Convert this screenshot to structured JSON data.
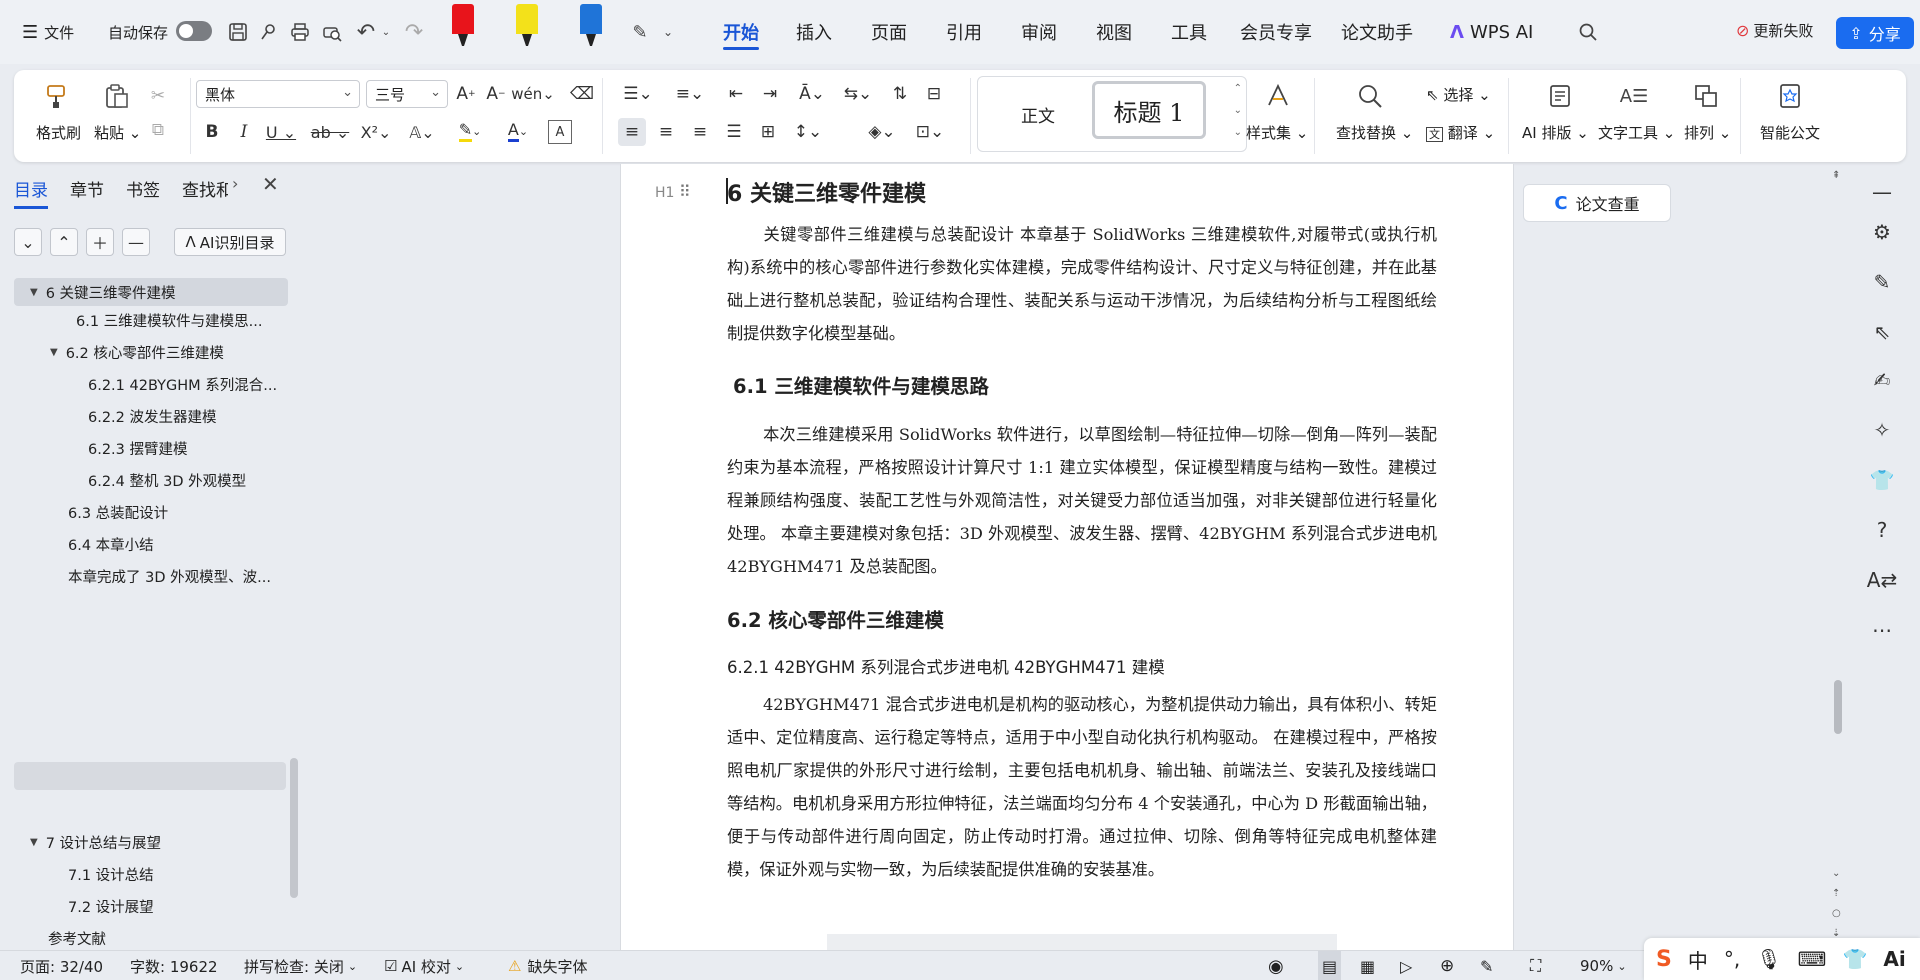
{
  "topbar": {
    "menu": "文件",
    "autosave": "自动保存",
    "tabs": [
      "开始",
      "插入",
      "页面",
      "引用",
      "审阅",
      "视图",
      "工具",
      "会员专享",
      "论文助手",
      "WPS AI"
    ],
    "update_status": "更新失败",
    "share": "分享",
    "pen_colors": [
      "#e8141b",
      "#f3e11a",
      "#1f74d8"
    ]
  },
  "ribbon": {
    "format_painter": "格式刷",
    "paste": "粘贴",
    "font_name": "黑体",
    "font_size": "三号",
    "style_normal": "正文",
    "style_heading": "标题 1",
    "style_set": "样式集",
    "find_replace": "查找替换",
    "select": "选择",
    "translate": "翻译",
    "ai_layout": "AI 排版",
    "text_tools": "文字工具",
    "arrange": "排列",
    "smart_doc": "智能公文",
    "font_color": "#1a3fd0",
    "highlight_color": "#f5d90a"
  },
  "left_panel": {
    "tabs": [
      "目录",
      "章节",
      "书签",
      "查找和"
    ],
    "ai_toc_button": "AI识别目录",
    "toc": [
      {
        "text": "6  关键三维零件建模"
      },
      {
        "text": "6.1  三维建模软件与建模思..."
      },
      {
        "text": "6.2  核心零部件三维建模"
      },
      {
        "text": "6.2.1 42BYGHM 系列混合..."
      },
      {
        "text": "6.2.2  波发生器建模"
      },
      {
        "text": "6.2.3  摆臂建模"
      },
      {
        "text": "6.2.4  整机 3D 外观模型"
      },
      {
        "text": "6.3  总装配设计"
      },
      {
        "text": "6.4  本章小结"
      },
      {
        "text": "本章完成了 3D 外观模型、波..."
      },
      {
        "text": "7  设计总结与展望"
      },
      {
        "text": "7.1  设计总结"
      },
      {
        "text": "7.2  设计展望"
      },
      {
        "text": "参考文献"
      }
    ]
  },
  "document": {
    "heading_marker": "H1",
    "title_num": "6",
    "title": "关键三维零件建模",
    "p1": "关键零部件三维建模与总装配设计  本章基于 SolidWorks 三维建模软件,对履带式(或执行机构)系统中的核心零部件进行参数化实体建模，完成零件结构设计、尺寸定义与特征创建，并在此基础上进行整机总装配，验证结构合理性、装配关系与运动干涉情况，为后续结构分析与工程图纸绘制提供数字化模型基础。",
    "h61": "6.1  三维建模软件与建模思路",
    "p2": "本次三维建模采用 SolidWorks 软件进行，以草图绘制—特征拉伸—切除—倒角—阵列—装配约束为基本流程，严格按照设计计算尺寸 1:1 建立实体模型，保证模型精度与结构一致性。建模过程兼顾结构强度、装配工艺性与外观简洁性，对关键受力部位适当加强，对非关键部位进行轻量化处理。  本章主要建模对象包括：3D 外观模型、波发生器、摆臂、42BYGHM 系列混合式步进电机 42BYGHM471 及总装配图。",
    "h62": "6.2  核心零部件三维建模",
    "h621": "6.2.1 42BYGHM 系列混合式步进电机 42BYGHM471 建模",
    "p3": "42BYGHM471 混合式步进电机是机构的驱动核心，为整机提供动力输出，具有体积小、转矩适中、定位精度高、运行稳定等特点，适用于中小型自动化执行机构驱动。  在建模过程中，严格按照电机厂家提供的外形尺寸进行绘制，主要包括电机机身、输出轴、前端法兰、安装孔及接线端口等结构。电机机身采用方形拉伸特征，法兰端面均匀分布 4 个安装通孔，中心为 D 形截面输出轴，便于与传动部件进行周向固定，防止传动时打滑。通过拉伸、切除、倒角等特征完成电机整体建模，保证外观与实物一致，为后续装配提供准确的安装基准。"
  },
  "right_panel": {
    "paper_check": "论文查重"
  },
  "status": {
    "page": "页面: 32/40",
    "words": "字数: 19622",
    "spell": "拼写检查: 关闭",
    "ai_check": "AI 校对",
    "missing_font": "缺失字体",
    "zoom": "90%"
  },
  "ime": {
    "lang": "中"
  }
}
